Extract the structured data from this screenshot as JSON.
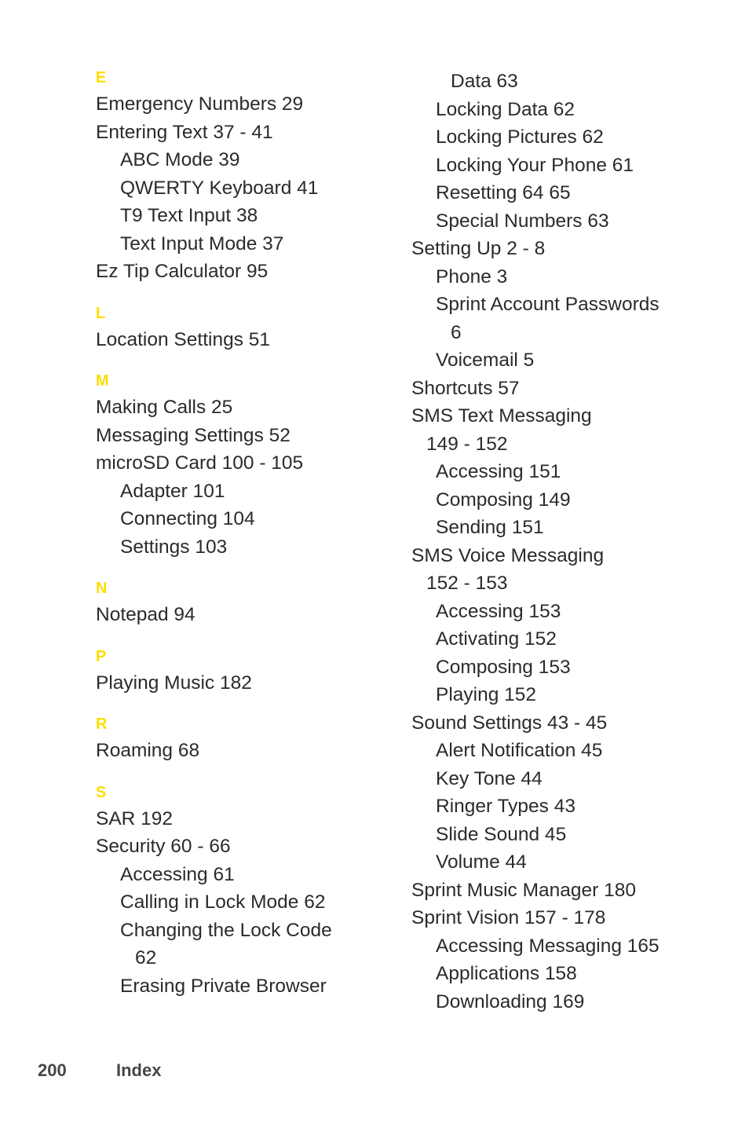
{
  "page": {
    "number": "200",
    "label": "Index",
    "accent_color": "#ffdd00",
    "text_color": "#2b2b2b",
    "footer_color": "#464646",
    "background_color": "#ffffff"
  },
  "columns": [
    {
      "name": "left-column",
      "sections": [
        {
          "letter": "E",
          "entries": [
            {
              "text": "Emergency Numbers 29",
              "level": 0,
              "continuation": false
            },
            {
              "text": "Entering Text 37 - 41",
              "level": 0,
              "continuation": false
            },
            {
              "text": "ABC Mode 39",
              "level": 1,
              "continuation": false
            },
            {
              "text": "QWERTY Keyboard 41",
              "level": 1,
              "continuation": false
            },
            {
              "text": "T9 Text Input 38",
              "level": 1,
              "continuation": false
            },
            {
              "text": "Text Input Mode 37",
              "level": 1,
              "continuation": false
            },
            {
              "text": "Ez Tip Calculator 95",
              "level": 0,
              "continuation": false
            }
          ]
        },
        {
          "letter": "L",
          "entries": [
            {
              "text": "Location Settings 51",
              "level": 0,
              "continuation": false
            }
          ]
        },
        {
          "letter": "M",
          "entries": [
            {
              "text": "Making Calls 25",
              "level": 0,
              "continuation": false
            },
            {
              "text": "Messaging Settings 52",
              "level": 0,
              "continuation": false
            },
            {
              "text": "microSD Card 100 - 105",
              "level": 0,
              "continuation": false
            },
            {
              "text": "Adapter 101",
              "level": 1,
              "continuation": false
            },
            {
              "text": "Connecting 104",
              "level": 1,
              "continuation": false
            },
            {
              "text": "Settings 103",
              "level": 1,
              "continuation": false
            }
          ]
        },
        {
          "letter": "N",
          "entries": [
            {
              "text": "Notepad 94",
              "level": 0,
              "continuation": false
            }
          ]
        },
        {
          "letter": "P",
          "entries": [
            {
              "text": "Playing Music 182",
              "level": 0,
              "continuation": false
            }
          ]
        },
        {
          "letter": "R",
          "entries": [
            {
              "text": "Roaming 68",
              "level": 0,
              "continuation": false
            }
          ]
        },
        {
          "letter": "S",
          "entries": [
            {
              "text": "SAR 192",
              "level": 0,
              "continuation": false
            },
            {
              "text": "Security 60 - 66",
              "level": 0,
              "continuation": false
            },
            {
              "text": "Accessing 61",
              "level": 1,
              "continuation": false
            },
            {
              "text": "Calling in Lock Mode 62",
              "level": 1,
              "continuation": false
            },
            {
              "text": "Changing the Lock Code",
              "level": 1,
              "continuation": false
            },
            {
              "text": "62",
              "level": 1,
              "continuation": true
            },
            {
              "text": "Erasing Private Browser",
              "level": 1,
              "continuation": false
            }
          ]
        }
      ]
    },
    {
      "name": "right-column",
      "sections": [
        {
          "letter": "",
          "entries": [
            {
              "text": "Data 63",
              "level": 1,
              "continuation": true
            },
            {
              "text": "Locking Data 62",
              "level": 1,
              "continuation": false
            },
            {
              "text": "Locking Pictures 62",
              "level": 1,
              "continuation": false
            },
            {
              "text": "Locking Your Phone 61",
              "level": 1,
              "continuation": false
            },
            {
              "text": "Resetting 64 65",
              "level": 1,
              "continuation": false
            },
            {
              "text": "Special Numbers 63",
              "level": 1,
              "continuation": false
            },
            {
              "text": "Setting Up 2 - 8",
              "level": 0,
              "continuation": false
            },
            {
              "text": "Phone 3",
              "level": 1,
              "continuation": false
            },
            {
              "text": "Sprint Account Passwords",
              "level": 1,
              "continuation": false
            },
            {
              "text": "6",
              "level": 1,
              "continuation": true
            },
            {
              "text": "Voicemail 5",
              "level": 1,
              "continuation": false
            },
            {
              "text": "Shortcuts 57",
              "level": 0,
              "continuation": false
            },
            {
              "text": "SMS Text Messaging",
              "level": 0,
              "continuation": false
            },
            {
              "text": "149 - 152",
              "level": 0,
              "continuation": true
            },
            {
              "text": "Accessing 151",
              "level": 1,
              "continuation": false
            },
            {
              "text": "Composing 149",
              "level": 1,
              "continuation": false
            },
            {
              "text": "Sending 151",
              "level": 1,
              "continuation": false
            },
            {
              "text": "SMS Voice Messaging",
              "level": 0,
              "continuation": false
            },
            {
              "text": "152 - 153",
              "level": 0,
              "continuation": true
            },
            {
              "text": "Accessing 153",
              "level": 1,
              "continuation": false
            },
            {
              "text": "Activating 152",
              "level": 1,
              "continuation": false
            },
            {
              "text": "Composing 153",
              "level": 1,
              "continuation": false
            },
            {
              "text": "Playing 152",
              "level": 1,
              "continuation": false
            },
            {
              "text": "Sound Settings 43 - 45",
              "level": 0,
              "continuation": false
            },
            {
              "text": "Alert Notification 45",
              "level": 1,
              "continuation": false
            },
            {
              "text": "Key Tone 44",
              "level": 1,
              "continuation": false
            },
            {
              "text": "Ringer Types 43",
              "level": 1,
              "continuation": false
            },
            {
              "text": "Slide Sound 45",
              "level": 1,
              "continuation": false
            },
            {
              "text": "Volume 44",
              "level": 1,
              "continuation": false
            },
            {
              "text": "Sprint Music Manager 180",
              "level": 0,
              "continuation": false
            },
            {
              "text": "Sprint Vision 157 - 178",
              "level": 0,
              "continuation": false
            },
            {
              "text": "Accessing Messaging 165",
              "level": 1,
              "continuation": false
            },
            {
              "text": "Applications 158",
              "level": 1,
              "continuation": false
            },
            {
              "text": "Downloading 169",
              "level": 1,
              "continuation": false
            }
          ]
        }
      ]
    }
  ]
}
